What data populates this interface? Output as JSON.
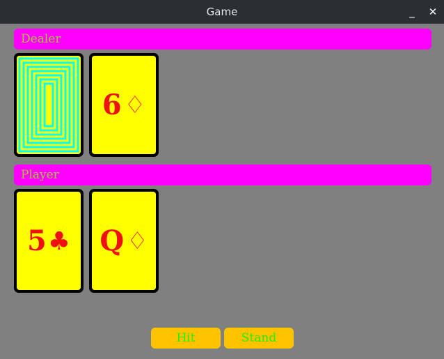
{
  "window": {
    "title": "Game",
    "minimize_glyph": "_",
    "close_glyph": "✕"
  },
  "dealer": {
    "label": "Dealer",
    "cards": [
      {
        "hidden": true
      },
      {
        "rank": "6",
        "suit": "♢",
        "suit_name": "diamonds"
      }
    ]
  },
  "player": {
    "label": "Player",
    "cards": [
      {
        "rank": "5",
        "suit": "♣",
        "suit_name": "clubs"
      },
      {
        "rank": "Q",
        "suit": "♢",
        "suit_name": "diamonds"
      }
    ]
  },
  "controls": {
    "hit_label": "Hit",
    "stand_label": "Stand"
  },
  "colors": {
    "background": "#808080",
    "header_bg": "#ff00ff",
    "header_text": "#9acd32",
    "card_face": "#ffff00",
    "card_text": "#ee1111",
    "card_back_pattern": "#00ffff",
    "button_bg": "#ffc300",
    "button_text": "#22ee00"
  }
}
